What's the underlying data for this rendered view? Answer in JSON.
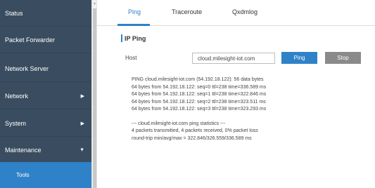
{
  "sidebar": {
    "items": [
      {
        "label": "Status"
      },
      {
        "label": "Packet Forwarder"
      },
      {
        "label": "Network Server"
      },
      {
        "label": "Network",
        "arrow": "▶"
      },
      {
        "label": "System",
        "arrow": "▶"
      },
      {
        "label": "Maintenance",
        "arrow": "▼"
      }
    ],
    "sub_item": {
      "label": "Tools"
    }
  },
  "tabs": [
    {
      "label": "Ping",
      "active": true
    },
    {
      "label": "Traceroute",
      "active": false
    },
    {
      "label": "Qxdmlog",
      "active": false
    }
  ],
  "section": {
    "title": "IP Ping"
  },
  "host": {
    "label": "Host",
    "value": "cloud.milesight-iot.com",
    "ping_label": "Ping",
    "stop_label": "Stop"
  },
  "output": {
    "lines": [
      "PING cloud.milesight-iot.com (54.192.18.122): 56 data bytes",
      "64 bytes from 54.192.18.122: seq=0 ttl=238 time=336.589 ms",
      "64 bytes from 54.192.18.122: seq=1 ttl=238 time=322.846 ms",
      "64 bytes from 54.192.18.122: seq=2 ttl=238 time=323.511 ms",
      "64 bytes from 54.192.18.122: seq=3 ttl=238 time=323.293 ms"
    ],
    "stats": [
      "--- cloud.milesight-iot.com ping statistics ---",
      "4 packets transmitted, 4 packets received, 0% packet loss",
      "round-trip min/avg/max = 322.846/326.559/336.589 ms"
    ]
  },
  "colors": {
    "sidebar_bg": "#3a4d60",
    "accent": "#2f82c7",
    "stop_button": "#8a8a8a"
  }
}
